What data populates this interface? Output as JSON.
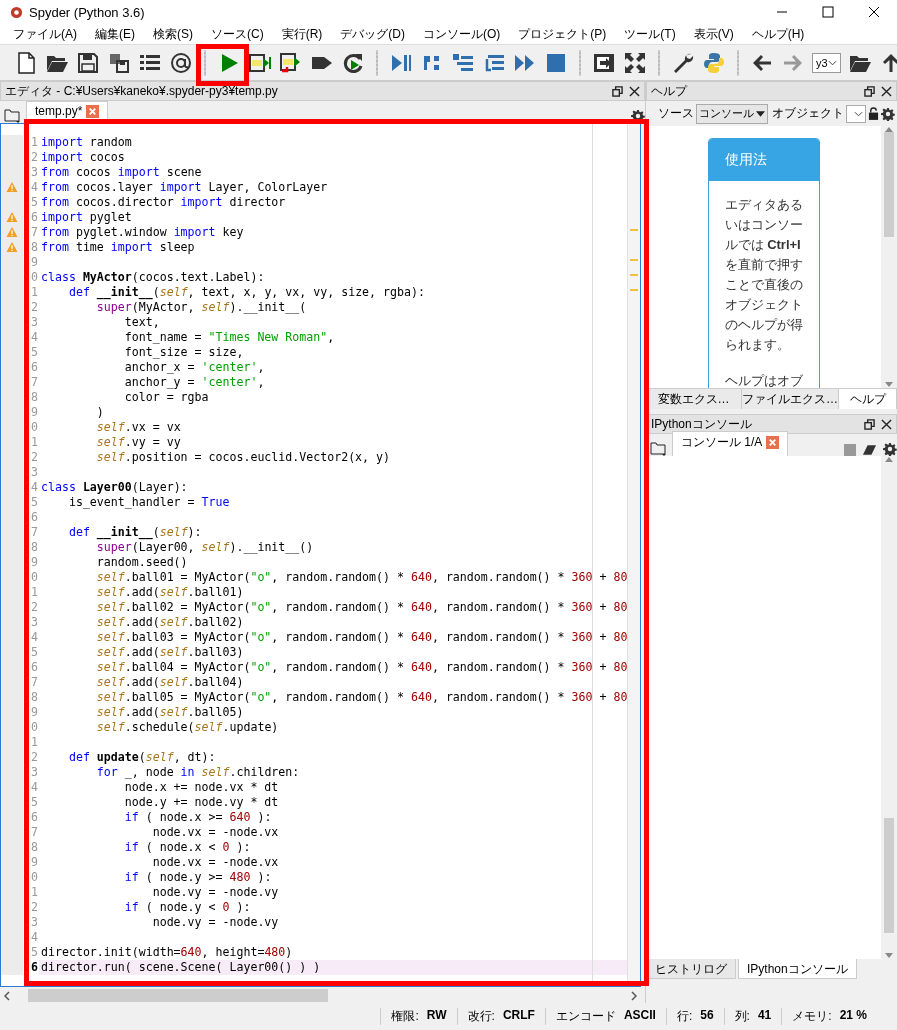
{
  "window": {
    "title": "Spyder (Python 3.6)"
  },
  "menu": [
    "ファイル(A)",
    "編集(E)",
    "検索(S)",
    "ソース(C)",
    "実行(R)",
    "デバッグ(D)",
    "コンソール(O)",
    "プロジェクト(P)",
    "ツール(T)",
    "表示(V)",
    "ヘルプ(H)"
  ],
  "toolbar": {
    "path_combo": "y3"
  },
  "editor": {
    "title": "エディタ - C:¥Users¥kaneko¥.spyder-py3¥temp.py",
    "tabs": [
      {
        "label": "temp.py*",
        "selected": true
      }
    ],
    "lines": [
      {
        "n": "1",
        "warning": false,
        "current": false,
        "code": [
          {
            "kind": "keyword",
            "text": "import"
          },
          {
            "kind": "plain",
            "text": " random"
          }
        ]
      },
      {
        "n": "2",
        "warning": false,
        "current": false,
        "code": [
          {
            "kind": "keyword",
            "text": "import"
          },
          {
            "kind": "plain",
            "text": " cocos"
          }
        ]
      },
      {
        "n": "3",
        "warning": false,
        "current": false,
        "code": [
          {
            "kind": "keyword",
            "text": "from"
          },
          {
            "kind": "plain",
            "text": " cocos "
          },
          {
            "kind": "keyword",
            "text": "import"
          },
          {
            "kind": "plain",
            "text": " scene"
          }
        ]
      },
      {
        "n": "4",
        "warning": true,
        "current": false,
        "code": [
          {
            "kind": "keyword",
            "text": "from"
          },
          {
            "kind": "plain",
            "text": " cocos.layer "
          },
          {
            "kind": "keyword",
            "text": "import"
          },
          {
            "kind": "plain",
            "text": " Layer, ColorLayer"
          }
        ]
      },
      {
        "n": "5",
        "warning": false,
        "current": false,
        "code": [
          {
            "kind": "keyword",
            "text": "from"
          },
          {
            "kind": "plain",
            "text": " cocos.director "
          },
          {
            "kind": "keyword",
            "text": "import"
          },
          {
            "kind": "plain",
            "text": " director"
          }
        ]
      },
      {
        "n": "6",
        "warning": true,
        "current": false,
        "code": [
          {
            "kind": "keyword",
            "text": "import"
          },
          {
            "kind": "plain",
            "text": " pyglet"
          }
        ]
      },
      {
        "n": "7",
        "warning": true,
        "current": false,
        "code": [
          {
            "kind": "keyword",
            "text": "from"
          },
          {
            "kind": "plain",
            "text": " pyglet.window "
          },
          {
            "kind": "keyword",
            "text": "import"
          },
          {
            "kind": "plain",
            "text": " key"
          }
        ]
      },
      {
        "n": "8",
        "warning": true,
        "current": false,
        "code": [
          {
            "kind": "keyword",
            "text": "from"
          },
          {
            "kind": "plain",
            "text": " time "
          },
          {
            "kind": "keyword",
            "text": "import"
          },
          {
            "kind": "plain",
            "text": " sleep"
          }
        ]
      },
      {
        "n": "9",
        "warning": false,
        "current": false
      },
      {
        "n": "0",
        "warning": false,
        "current": false,
        "code": [
          {
            "kind": "keyword",
            "text": "class"
          },
          {
            "kind": "name",
            "text": " MyActor"
          },
          {
            "kind": "plain",
            "text": "(cocos.text.Label):"
          }
        ]
      },
      {
        "n": "1",
        "warning": false,
        "current": false,
        "code": [
          {
            "kind": "keyword",
            "text": "    def"
          },
          {
            "kind": "name",
            "text": " __init__"
          },
          {
            "kind": "plain",
            "text": "("
          },
          {
            "kind": "self",
            "text": "self"
          },
          {
            "kind": "plain",
            "text": ", text, x, y, vx, vy, size, rgba):"
          }
        ]
      },
      {
        "n": "2",
        "warning": false,
        "current": false,
        "code": [
          {
            "kind": "builtin",
            "text": "        super"
          },
          {
            "kind": "plain",
            "text": "(MyActor, "
          },
          {
            "kind": "self",
            "text": "self"
          },
          {
            "kind": "plain",
            "text": ").__init__("
          }
        ]
      },
      {
        "n": "3",
        "warning": false,
        "current": false,
        "code": [
          {
            "kind": "plain",
            "text": "            text,"
          }
        ]
      },
      {
        "n": "4",
        "warning": false,
        "current": false,
        "code": [
          {
            "kind": "plain",
            "text": "            font_name = "
          },
          {
            "kind": "string",
            "text": "\"Times New Roman\""
          },
          {
            "kind": "plain",
            "text": ","
          }
        ]
      },
      {
        "n": "5",
        "warning": false,
        "current": false,
        "code": [
          {
            "kind": "plain",
            "text": "            font_size = size,"
          }
        ]
      },
      {
        "n": "6",
        "warning": false,
        "current": false,
        "code": [
          {
            "kind": "plain",
            "text": "            anchor_x = "
          },
          {
            "kind": "string",
            "text": "'center'"
          },
          {
            "kind": "plain",
            "text": ","
          }
        ]
      },
      {
        "n": "7",
        "warning": false,
        "current": false,
        "code": [
          {
            "kind": "plain",
            "text": "            anchor_y = "
          },
          {
            "kind": "string",
            "text": "'center'"
          },
          {
            "kind": "plain",
            "text": ","
          }
        ]
      },
      {
        "n": "8",
        "warning": false,
        "current": false,
        "code": [
          {
            "kind": "plain",
            "text": "            color = rgba"
          }
        ]
      },
      {
        "n": "9",
        "warning": false,
        "current": false,
        "code": [
          {
            "kind": "plain",
            "text": "        )"
          }
        ]
      },
      {
        "n": "0",
        "warning": false,
        "current": false,
        "code": [
          {
            "kind": "self",
            "text": "        self"
          },
          {
            "kind": "plain",
            "text": ".vx = vx"
          }
        ]
      },
      {
        "n": "1",
        "warning": false,
        "current": false,
        "code": [
          {
            "kind": "self",
            "text": "        self"
          },
          {
            "kind": "plain",
            "text": ".vy = vy"
          }
        ]
      },
      {
        "n": "2",
        "warning": false,
        "current": false,
        "code": [
          {
            "kind": "self",
            "text": "        self"
          },
          {
            "kind": "plain",
            "text": ".position = cocos.euclid.Vector2(x, y)"
          }
        ]
      },
      {
        "n": "3",
        "warning": false,
        "current": false
      },
      {
        "n": "4",
        "warning": false,
        "current": false,
        "code": [
          {
            "kind": "keyword",
            "text": "class"
          },
          {
            "kind": "name",
            "text": " Layer00"
          },
          {
            "kind": "plain",
            "text": "(Layer):"
          }
        ]
      },
      {
        "n": "5",
        "warning": false,
        "current": false,
        "code": [
          {
            "kind": "plain",
            "text": "    is_event_handler = "
          },
          {
            "kind": "keyword",
            "text": "True"
          }
        ]
      },
      {
        "n": "6",
        "warning": false,
        "current": false
      },
      {
        "n": "7",
        "warning": false,
        "current": false,
        "code": [
          {
            "kind": "keyword",
            "text": "    def"
          },
          {
            "kind": "name",
            "text": " __init__"
          },
          {
            "kind": "plain",
            "text": "("
          },
          {
            "kind": "self",
            "text": "self"
          },
          {
            "kind": "plain",
            "text": "):"
          }
        ]
      },
      {
        "n": "8",
        "warning": false,
        "current": false,
        "code": [
          {
            "kind": "builtin",
            "text": "        super"
          },
          {
            "kind": "plain",
            "text": "(Layer00, "
          },
          {
            "kind": "self",
            "text": "self"
          },
          {
            "kind": "plain",
            "text": ").__init__()"
          }
        ]
      },
      {
        "n": "9",
        "warning": false,
        "current": false,
        "code": [
          {
            "kind": "plain",
            "text": "        random.seed()"
          }
        ]
      },
      {
        "n": "0",
        "warning": false,
        "current": false,
        "code": [
          {
            "kind": "self",
            "text": "        self"
          },
          {
            "kind": "plain",
            "text": ".ball01 = MyActor("
          },
          {
            "kind": "string",
            "text": "\"o\""
          },
          {
            "kind": "plain",
            "text": ", random.random() * "
          },
          {
            "kind": "number",
            "text": "640"
          },
          {
            "kind": "plain",
            "text": ", random.random() * "
          },
          {
            "kind": "number",
            "text": "360"
          },
          {
            "kind": "plain",
            "text": " + "
          },
          {
            "kind": "number",
            "text": "80"
          }
        ]
      },
      {
        "n": "1",
        "warning": false,
        "current": false,
        "code": [
          {
            "kind": "self",
            "text": "        self"
          },
          {
            "kind": "plain",
            "text": ".add("
          },
          {
            "kind": "self",
            "text": "self"
          },
          {
            "kind": "plain",
            "text": ".ball01)"
          }
        ]
      },
      {
        "n": "2",
        "warning": false,
        "current": false,
        "code": [
          {
            "kind": "self",
            "text": "        self"
          },
          {
            "kind": "plain",
            "text": ".ball02 = MyActor("
          },
          {
            "kind": "string",
            "text": "\"o\""
          },
          {
            "kind": "plain",
            "text": ", random.random() * "
          },
          {
            "kind": "number",
            "text": "640"
          },
          {
            "kind": "plain",
            "text": ", random.random() * "
          },
          {
            "kind": "number",
            "text": "360"
          },
          {
            "kind": "plain",
            "text": " + "
          },
          {
            "kind": "number",
            "text": "80"
          }
        ]
      },
      {
        "n": "3",
        "warning": false,
        "current": false,
        "code": [
          {
            "kind": "self",
            "text": "        self"
          },
          {
            "kind": "plain",
            "text": ".add("
          },
          {
            "kind": "self",
            "text": "self"
          },
          {
            "kind": "plain",
            "text": ".ball02)"
          }
        ]
      },
      {
        "n": "4",
        "warning": false,
        "current": false,
        "code": [
          {
            "kind": "self",
            "text": "        self"
          },
          {
            "kind": "plain",
            "text": ".ball03 = MyActor("
          },
          {
            "kind": "string",
            "text": "\"o\""
          },
          {
            "kind": "plain",
            "text": ", random.random() * "
          },
          {
            "kind": "number",
            "text": "640"
          },
          {
            "kind": "plain",
            "text": ", random.random() * "
          },
          {
            "kind": "number",
            "text": "360"
          },
          {
            "kind": "plain",
            "text": " + "
          },
          {
            "kind": "number",
            "text": "80"
          }
        ]
      },
      {
        "n": "5",
        "warning": false,
        "current": false,
        "code": [
          {
            "kind": "self",
            "text": "        self"
          },
          {
            "kind": "plain",
            "text": ".add("
          },
          {
            "kind": "self",
            "text": "self"
          },
          {
            "kind": "plain",
            "text": ".ball03)"
          }
        ]
      },
      {
        "n": "6",
        "warning": false,
        "current": false,
        "code": [
          {
            "kind": "self",
            "text": "        self"
          },
          {
            "kind": "plain",
            "text": ".ball04 = MyActor("
          },
          {
            "kind": "string",
            "text": "\"o\""
          },
          {
            "kind": "plain",
            "text": ", random.random() * "
          },
          {
            "kind": "number",
            "text": "640"
          },
          {
            "kind": "plain",
            "text": ", random.random() * "
          },
          {
            "kind": "number",
            "text": "360"
          },
          {
            "kind": "plain",
            "text": " + "
          },
          {
            "kind": "number",
            "text": "80"
          }
        ]
      },
      {
        "n": "7",
        "warning": false,
        "current": false,
        "code": [
          {
            "kind": "self",
            "text": "        self"
          },
          {
            "kind": "plain",
            "text": ".add("
          },
          {
            "kind": "self",
            "text": "self"
          },
          {
            "kind": "plain",
            "text": ".ball04)"
          }
        ]
      },
      {
        "n": "8",
        "warning": false,
        "current": false,
        "code": [
          {
            "kind": "self",
            "text": "        self"
          },
          {
            "kind": "plain",
            "text": ".ball05 = MyActor("
          },
          {
            "kind": "string",
            "text": "\"o\""
          },
          {
            "kind": "plain",
            "text": ", random.random() * "
          },
          {
            "kind": "number",
            "text": "640"
          },
          {
            "kind": "plain",
            "text": ", random.random() * "
          },
          {
            "kind": "number",
            "text": "360"
          },
          {
            "kind": "plain",
            "text": " + "
          },
          {
            "kind": "number",
            "text": "80"
          }
        ]
      },
      {
        "n": "9",
        "warning": false,
        "current": false,
        "code": [
          {
            "kind": "self",
            "text": "        self"
          },
          {
            "kind": "plain",
            "text": ".add("
          },
          {
            "kind": "self",
            "text": "self"
          },
          {
            "kind": "plain",
            "text": ".ball05)"
          }
        ]
      },
      {
        "n": "0",
        "warning": false,
        "current": false,
        "code": [
          {
            "kind": "self",
            "text": "        self"
          },
          {
            "kind": "plain",
            "text": ".schedule("
          },
          {
            "kind": "self",
            "text": "self"
          },
          {
            "kind": "plain",
            "text": ".update)"
          }
        ]
      },
      {
        "n": "1",
        "warning": false,
        "current": false
      },
      {
        "n": "2",
        "warning": false,
        "current": false,
        "code": [
          {
            "kind": "keyword",
            "text": "    def"
          },
          {
            "kind": "name",
            "text": " update"
          },
          {
            "kind": "plain",
            "text": "("
          },
          {
            "kind": "self",
            "text": "self"
          },
          {
            "kind": "plain",
            "text": ", dt):"
          }
        ]
      },
      {
        "n": "3",
        "warning": false,
        "current": false,
        "code": [
          {
            "kind": "keyword",
            "text": "        for"
          },
          {
            "kind": "plain",
            "text": " _, node "
          },
          {
            "kind": "keyword",
            "text": "in"
          },
          {
            "kind": "self",
            "text": " self"
          },
          {
            "kind": "plain",
            "text": ".children:"
          }
        ]
      },
      {
        "n": "4",
        "warning": false,
        "current": false,
        "code": [
          {
            "kind": "plain",
            "text": "            node.x += node.vx * dt"
          }
        ]
      },
      {
        "n": "5",
        "warning": false,
        "current": false,
        "code": [
          {
            "kind": "plain",
            "text": "            node.y += node.vy * dt"
          }
        ]
      },
      {
        "n": "6",
        "warning": false,
        "current": false,
        "code": [
          {
            "kind": "keyword",
            "text": "            if"
          },
          {
            "kind": "plain",
            "text": " ( node.x >= "
          },
          {
            "kind": "number",
            "text": "640"
          },
          {
            "kind": "plain",
            "text": " ):"
          }
        ]
      },
      {
        "n": "7",
        "warning": false,
        "current": false,
        "code": [
          {
            "kind": "plain",
            "text": "                node.vx = -node.vx"
          }
        ]
      },
      {
        "n": "8",
        "warning": false,
        "current": false,
        "code": [
          {
            "kind": "keyword",
            "text": "            if"
          },
          {
            "kind": "plain",
            "text": " ( node.x < "
          },
          {
            "kind": "number",
            "text": "0"
          },
          {
            "kind": "plain",
            "text": " ):"
          }
        ]
      },
      {
        "n": "9",
        "warning": false,
        "current": false,
        "code": [
          {
            "kind": "plain",
            "text": "                node.vx = -node.vx"
          }
        ]
      },
      {
        "n": "0",
        "warning": false,
        "current": false,
        "code": [
          {
            "kind": "keyword",
            "text": "            if"
          },
          {
            "kind": "plain",
            "text": " ( node.y >= "
          },
          {
            "kind": "number",
            "text": "480"
          },
          {
            "kind": "plain",
            "text": " ):"
          }
        ]
      },
      {
        "n": "1",
        "warning": false,
        "current": false,
        "code": [
          {
            "kind": "plain",
            "text": "                node.vy = -node.vy"
          }
        ]
      },
      {
        "n": "2",
        "warning": false,
        "current": false,
        "code": [
          {
            "kind": "keyword",
            "text": "            if"
          },
          {
            "kind": "plain",
            "text": " ( node.y < "
          },
          {
            "kind": "number",
            "text": "0"
          },
          {
            "kind": "plain",
            "text": " ):"
          }
        ]
      },
      {
        "n": "3",
        "warning": false,
        "current": false,
        "code": [
          {
            "kind": "plain",
            "text": "                node.vy = -node.vy"
          }
        ]
      },
      {
        "n": "4",
        "warning": false,
        "current": false
      },
      {
        "n": "5",
        "warning": false,
        "current": false,
        "code": [
          {
            "kind": "plain",
            "text": "director.init(width="
          },
          {
            "kind": "number",
            "text": "640"
          },
          {
            "kind": "plain",
            "text": ", height="
          },
          {
            "kind": "number",
            "text": "480"
          },
          {
            "kind": "plain",
            "text": ")"
          }
        ]
      },
      {
        "n": "6",
        "warning": false,
        "current": true,
        "code": [
          {
            "kind": "plain",
            "text": "director.run( scene.Scene( Layer00() ) )"
          }
        ]
      }
    ]
  },
  "help": {
    "title": "ヘルプ",
    "source_label": "ソース",
    "source_value": "コンソール",
    "object_label": "オブジェクト",
    "card_title": "使用法",
    "paragraphs": [
      "エディタあるいはコンソールでは **Ctrl+I** を直前で押すことで直後のオブジェクトのヘルプが得られます。",
      "ヘルプはオブ"
    ],
    "tabs": [
      {
        "label": "変数エクス…",
        "selected": false
      },
      {
        "label": "ファイルエクス…",
        "selected": false
      },
      {
        "label": "ヘルプ",
        "selected": true
      }
    ]
  },
  "console": {
    "title": "IPythonコンソール",
    "tabs": [
      {
        "label": "コンソール 1/A",
        "selected": true
      }
    ],
    "bottom_tabs": [
      {
        "label": "ヒストリログ",
        "selected": false
      },
      {
        "label": "IPythonコンソール",
        "selected": true
      }
    ]
  },
  "status_bar": [
    {
      "label": "権限:",
      "value": "RW"
    },
    {
      "label": "改行:",
      "value": "CRLF"
    },
    {
      "label": "エンコード",
      "value": "ASCII"
    },
    {
      "label": "行:",
      "value": "56"
    },
    {
      "label": "列:",
      "value": "41"
    },
    {
      "label": "メモリ:",
      "value": "21 %"
    }
  ]
}
